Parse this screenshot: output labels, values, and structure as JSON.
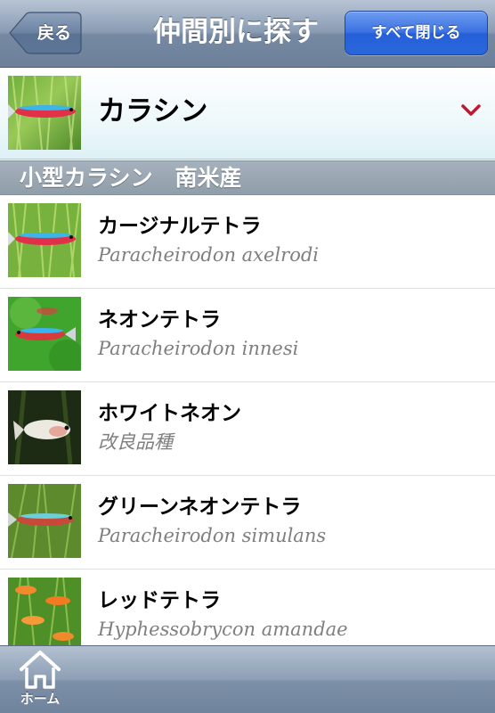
{
  "navbar": {
    "back_label": "戻る",
    "title": "仲間別に探す",
    "close_all_label": "すべて閉じる"
  },
  "category": {
    "label": "カラシン",
    "expanded": true
  },
  "section": {
    "title": "小型カラシン　南米産"
  },
  "fish": [
    {
      "name": "カージナルテトラ",
      "subtitle": "Paracheirodon axelrodi"
    },
    {
      "name": "ネオンテトラ",
      "subtitle": "Paracheirodon innesi"
    },
    {
      "name": "ホワイトネオン",
      "subtitle": "改良品種"
    },
    {
      "name": "グリーンネオンテトラ",
      "subtitle": "Paracheirodon simulans"
    },
    {
      "name": "レッドテトラ",
      "subtitle": "Hyphessobrycon amandae"
    }
  ],
  "toolbar": {
    "home_label": "ホーム"
  },
  "colors": {
    "nav_bar": "#8a9cb3",
    "accent_button": "#2560d9",
    "chevron": "#c0182e",
    "section_header": "#9aa7b4",
    "subtitle_text": "#7f7f7f"
  },
  "icons": [
    "back-arrow-icon",
    "chevron-down-icon",
    "home-icon"
  ]
}
